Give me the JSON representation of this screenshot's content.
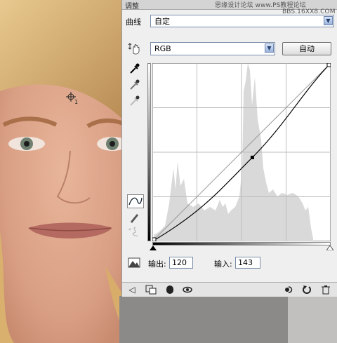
{
  "window": {
    "tab_label": "调整",
    "watermark_line1": "思缘设计论坛 www.PS教程论坛",
    "watermark_line2": "BBS.16XX8.COM"
  },
  "preset": {
    "label": "曲线",
    "value": "自定"
  },
  "channel": {
    "value": "RGB"
  },
  "auto_button": {
    "label": "自动"
  },
  "output": {
    "label": "输出:",
    "value": "120"
  },
  "input": {
    "label": "输入:",
    "value": "143"
  },
  "curve": {
    "selected_point": {
      "input": 143,
      "output": 120
    },
    "endpoints": [
      {
        "input": 0,
        "output": 0
      },
      {
        "input": 255,
        "output": 255
      }
    ]
  },
  "icons": {
    "hand_tool": "hand-adjust-icon",
    "black_eyedropper": "eyedropper-black-icon",
    "gray_eyedropper": "eyedropper-gray-icon",
    "white_eyedropper": "eyedropper-white-icon",
    "curve_tool": "curve-point-icon",
    "pencil_tool": "pencil-icon",
    "smooth_tool": "smooth-icon",
    "clipping_warning": "clipping-warning-icon",
    "back": "back-arrow-icon",
    "expand": "expand-view-icon",
    "mask": "mask-icon",
    "visibility": "eye-icon",
    "previous_state": "previous-state-icon",
    "reset": "reset-icon",
    "delete": "trash-icon"
  },
  "colors": {
    "panel_bg": "#efefef",
    "histogram": "#d9d9d9",
    "select_border": "#7a8da8"
  }
}
